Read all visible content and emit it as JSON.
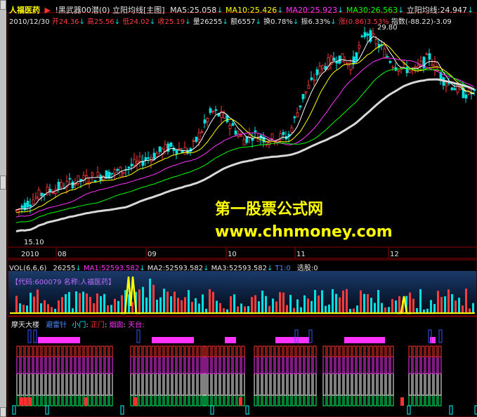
{
  "header": {
    "stock_name": "人福医药",
    "indicator": "!黑武器00潜(0)",
    "formula": "立阳均线[主图]",
    "ma5": "MA5:25.058",
    "ma10": "MA10:25.426",
    "ma20": "MA20:25.923",
    "ma30": "MA30:26.563",
    "line": "立阳均线:24.947"
  },
  "quote": {
    "date": "2010/12/30",
    "open": "开24.36",
    "high": "高25.56",
    "low": "低24.02",
    "close": "收25.19",
    "volume": "量26255",
    "amount": "额6557",
    "turnover": "换0.78%",
    "amplitude": "振6.33%",
    "change": "涨(0.86)3.53%",
    "index": "指数(-88.22)-3.09"
  },
  "main_chart": {
    "high_label": "29.80",
    "low_label": "15.10",
    "months": [
      "2010",
      "08",
      "09",
      "10",
      "11",
      "12"
    ]
  },
  "watermark": {
    "line1": "第一股票公式网",
    "line2": "www.chnmoney.com"
  },
  "vol_panel": {
    "title": "VOL(6,6,6)",
    "vol": "26255",
    "ma1": "MA1:52593.582",
    "ma2": "MA2:52593.582",
    "ma3": "MA3:52593.582",
    "t1": "T1:0",
    "select": "选股:0",
    "code_label": "【代码:600079  名称:人福医药】"
  },
  "sky_panel": {
    "title": "摩天大楼",
    "l1": "避雷针",
    "l2": "小门",
    "l3": "正门",
    "l4": "烟囱",
    "l5": "天台:"
  },
  "colors": {
    "background": "#000000",
    "up": "#ff3c3c",
    "down": "#00e0e0",
    "ma_white": "#ffffff",
    "ma_yellow": "#ffff00",
    "ma_magenta": "#ff33ff",
    "ma_green": "#00ff00",
    "watermark": "#ffff00"
  }
}
